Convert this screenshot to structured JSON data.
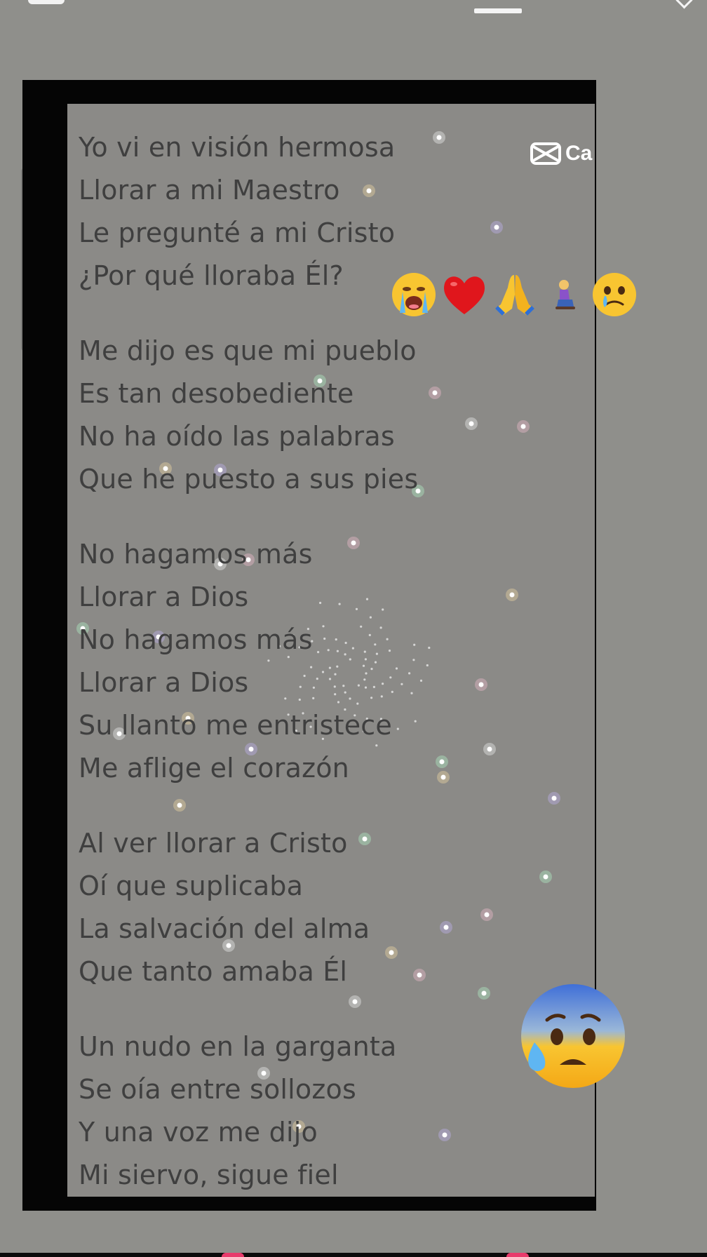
{
  "overlay": {
    "brand_label": "Ca",
    "brand_icon": "capcut-logo-icon"
  },
  "lyrics": {
    "stanzas": [
      [
        "Yo vi en visión hermosa",
        "Llorar a mi Maestro",
        "Le pregunté a mi Cristo",
        "¿Por qué lloraba Él?"
      ],
      [
        "Me dijo es que mi pueblo",
        "Es tan desobediente",
        "No ha oído las palabras",
        "Que he puesto a sus pies"
      ],
      [
        "No hagamos más",
        "Llorar a Dios",
        "No hagamos más",
        "Llorar a Dios",
        "Su llanto me entristece",
        "Me aflige el corazón"
      ],
      [
        "Al ver llorar a Cristo",
        "Oí que suplicaba",
        "La salvación del alma",
        "Que tanto amaba Él"
      ],
      [
        "Un nudo en la garganta",
        "Se oía entre sollozos",
        "Y una voz me dijo",
        "Mi siervo, sigue fiel"
      ]
    ]
  },
  "stickers": {
    "row": [
      "crying-face-icon",
      "red-heart-icon",
      "praying-hands-icon",
      "kneeling-woman-icon",
      "face-holding-back-tears-icon"
    ],
    "large": "anxious-face-with-sweat-icon"
  },
  "colors": {
    "background": "#8f8f8b",
    "video_background": "#8b8a87",
    "lyrics_text": "#3f3f3f",
    "frame": "#050505"
  }
}
